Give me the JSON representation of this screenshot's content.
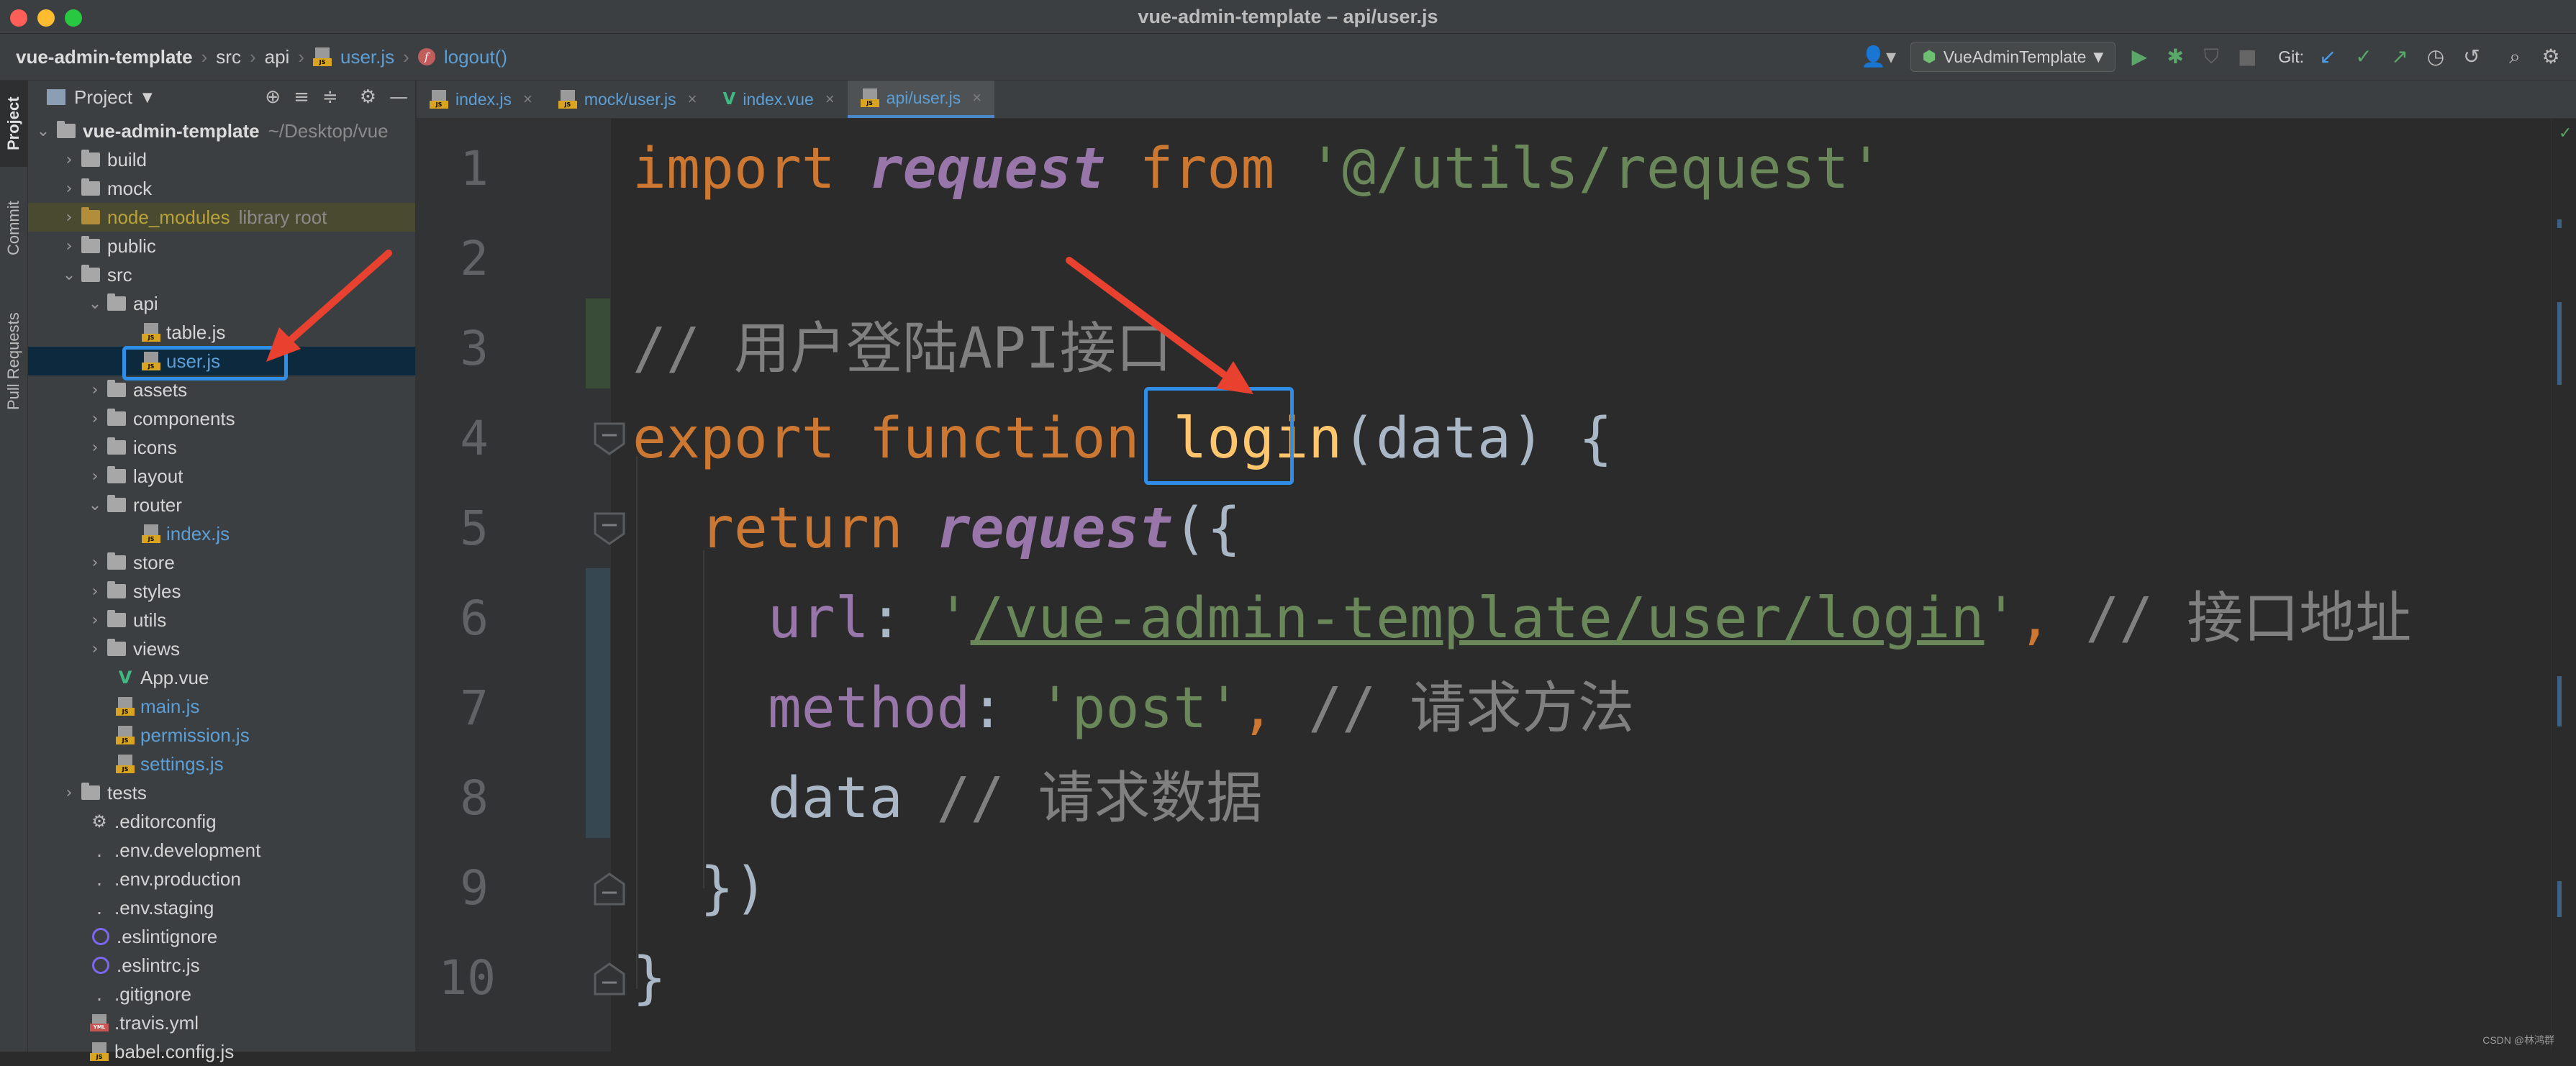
{
  "window": {
    "title": "vue-admin-template – api/user.js",
    "traffic_colors": [
      "#ff5f57",
      "#febc2e",
      "#28c840"
    ]
  },
  "navbar": {
    "breadcrumbs": [
      "vue-admin-template",
      "src",
      "api",
      "user.js",
      "logout()"
    ],
    "run_config": "VueAdminTemplate",
    "git_label": "Git:"
  },
  "left_strip": {
    "tabs": [
      "Project",
      "Commit",
      "Pull Requests"
    ]
  },
  "project_panel": {
    "title": "Project",
    "tree": [
      {
        "label": "vue-admin-template",
        "suffix": "~/Desktop/vue",
        "type": "root"
      },
      {
        "label": "build",
        "type": "folder"
      },
      {
        "label": "mock",
        "type": "folder"
      },
      {
        "label": "node_modules",
        "suffix": "library root",
        "type": "folder-excluded"
      },
      {
        "label": "public",
        "type": "folder"
      },
      {
        "label": "src",
        "type": "folder-open"
      },
      {
        "label": "api",
        "type": "folder-open"
      },
      {
        "label": "table.js",
        "type": "js"
      },
      {
        "label": "user.js",
        "type": "js-selected"
      },
      {
        "label": "assets",
        "type": "folder"
      },
      {
        "label": "components",
        "type": "folder"
      },
      {
        "label": "icons",
        "type": "folder"
      },
      {
        "label": "layout",
        "type": "folder"
      },
      {
        "label": "router",
        "type": "folder-open"
      },
      {
        "label": "index.js",
        "type": "js-blue"
      },
      {
        "label": "store",
        "type": "folder"
      },
      {
        "label": "styles",
        "type": "folder"
      },
      {
        "label": "utils",
        "type": "folder"
      },
      {
        "label": "views",
        "type": "folder"
      },
      {
        "label": "App.vue",
        "type": "vue"
      },
      {
        "label": "main.js",
        "type": "js-blue"
      },
      {
        "label": "permission.js",
        "type": "js-blue"
      },
      {
        "label": "settings.js",
        "type": "js-blue"
      },
      {
        "label": "tests",
        "type": "folder"
      },
      {
        "label": ".editorconfig",
        "type": "gear"
      },
      {
        "label": ".env.development",
        "type": "dot"
      },
      {
        "label": ".env.production",
        "type": "dot"
      },
      {
        "label": ".env.staging",
        "type": "dot"
      },
      {
        "label": ".eslintignore",
        "type": "ring"
      },
      {
        "label": ".eslintrc.js",
        "type": "ring"
      },
      {
        "label": ".gitignore",
        "type": "dot"
      },
      {
        "label": ".travis.yml",
        "type": "yml"
      },
      {
        "label": "babel.config.js",
        "type": "js"
      }
    ]
  },
  "tabs": [
    {
      "label": "index.js",
      "type": "js",
      "active": false
    },
    {
      "label": "mock/user.js",
      "type": "js",
      "active": false
    },
    {
      "label": "index.vue",
      "type": "vue",
      "active": false
    },
    {
      "label": "api/user.js",
      "type": "js",
      "active": true
    }
  ],
  "editor": {
    "line_numbers": [
      "1",
      "2",
      "3",
      "4",
      "5",
      "6",
      "7",
      "8",
      "9",
      "10"
    ],
    "code": {
      "l1": {
        "kw1": "import",
        "id": "request",
        "kw2": "from",
        "str": "'@/utils/request'"
      },
      "l3": {
        "cmt": "// 用户登陆API接口"
      },
      "l4": {
        "kw1": "export",
        "kw2": "function",
        "name": "login",
        "rest": "(data) {"
      },
      "l5": {
        "kw": "return",
        "fn": "request",
        "rest": "({"
      },
      "l6": {
        "prop": "url",
        "colon": ": ",
        "q1": "'",
        "str": "/vue-admin-template/user/login",
        "q2": "'",
        "comma": ",",
        "cmt": " // 接口地址"
      },
      "l7": {
        "prop": "method",
        "colon": ": ",
        "str": "'post'",
        "comma": ",",
        "cmt": " // 请求方法"
      },
      "l8": {
        "id": "data",
        "cmt": " // 请求数据"
      },
      "l9": {
        "text": "})"
      },
      "l10": {
        "text": "}"
      }
    }
  },
  "watermark": "CSDN @林鸿群",
  "colors": {
    "accent": "#2f8fe8",
    "arrow": "#e8412f"
  }
}
